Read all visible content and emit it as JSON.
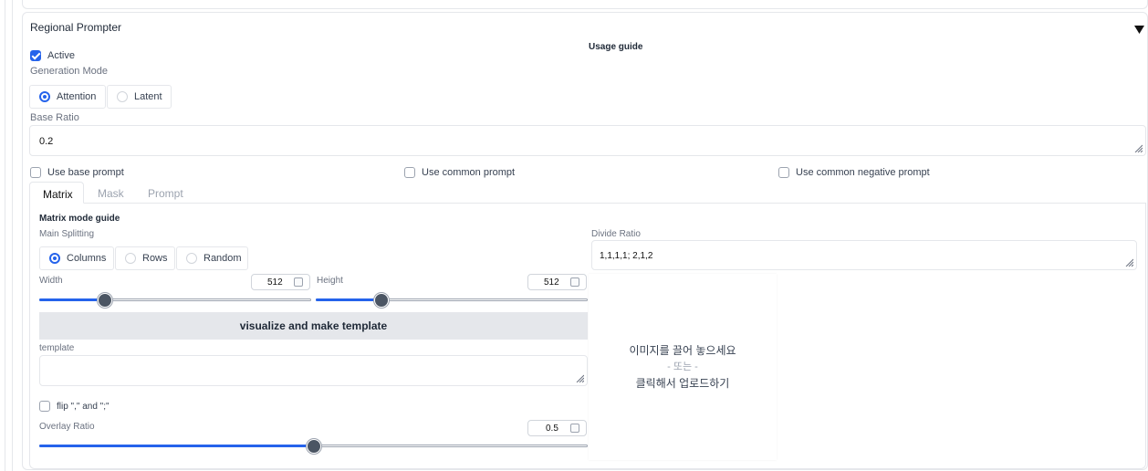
{
  "panel": {
    "title": "Regional Prompter",
    "collapse_icon": "triangle-down-icon",
    "usage_guide": "Usage guide"
  },
  "active": {
    "label": "Active",
    "checked": true
  },
  "generation_mode": {
    "label": "Generation Mode",
    "options": [
      {
        "label": "Attention",
        "selected": true
      },
      {
        "label": "Latent",
        "selected": false
      }
    ]
  },
  "base_ratio": {
    "label": "Base Ratio",
    "value": "0.2"
  },
  "checkboxes": {
    "use_base_prompt": {
      "label": "Use base prompt",
      "checked": false
    },
    "use_common_prompt": {
      "label": "Use common prompt",
      "checked": false
    },
    "use_common_negative_prompt": {
      "label": "Use common negative prompt",
      "checked": false
    }
  },
  "tabs": [
    {
      "label": "Matrix",
      "active": true
    },
    {
      "label": "Mask",
      "active": false
    },
    {
      "label": "Prompt",
      "active": false
    }
  ],
  "matrix": {
    "guide": "Matrix mode guide",
    "main_splitting": {
      "label": "Main Splitting",
      "options": [
        {
          "label": "Columns",
          "selected": true
        },
        {
          "label": "Rows",
          "selected": false
        },
        {
          "label": "Random",
          "selected": false
        }
      ]
    },
    "divide_ratio": {
      "label": "Divide Ratio",
      "value": "1,1,1,1; 2,1,2"
    },
    "width": {
      "label": "Width",
      "value": "512",
      "slider_fraction": 0.24
    },
    "height": {
      "label": "Height",
      "value": "512",
      "slider_fraction": 0.24
    },
    "visualize_button": "visualize and make template",
    "template": {
      "label": "template",
      "value": ""
    },
    "flip": {
      "label": "flip \",\" and \";\"",
      "checked": false
    },
    "overlay_ratio": {
      "label": "Overlay Ratio",
      "value": "0.5",
      "slider_fraction": 0.5
    },
    "upload": {
      "line1": "이미지를 끌어 놓으세요",
      "line2": "- 또는 -",
      "line3": "클릭해서 업로드하기"
    }
  },
  "colors": {
    "accent": "#2563eb",
    "border": "#e5e7eb",
    "button_bg": "#e5e7eb"
  }
}
